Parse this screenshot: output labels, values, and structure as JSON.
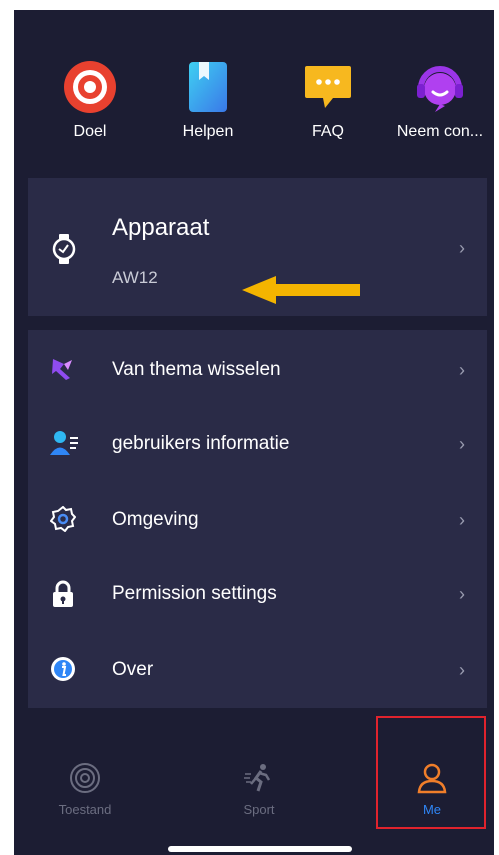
{
  "quick_actions": [
    {
      "label": "Doel",
      "icon": "target-icon"
    },
    {
      "label": "Helpen",
      "icon": "help-book-icon"
    },
    {
      "label": "FAQ",
      "icon": "chat-bubble-icon"
    },
    {
      "label": "Neem con...",
      "icon": "support-headset-icon"
    }
  ],
  "device": {
    "title": "Apparaat",
    "model": "AW12",
    "chevron": "›",
    "arrow_color": "#f4b400"
  },
  "menu": [
    {
      "label": "Van thema wisselen",
      "icon": "theme-flag-icon"
    },
    {
      "label": "gebruikers informatie",
      "icon": "user-info-icon"
    },
    {
      "label": "Omgeving",
      "icon": "settings-gear-icon"
    },
    {
      "label": "Permission settings",
      "icon": "lock-icon"
    },
    {
      "label": "Over",
      "icon": "info-icon"
    }
  ],
  "chevron": "›",
  "tabs": [
    {
      "label": "Toestand",
      "icon": "status-rings-icon",
      "active": false
    },
    {
      "label": "Sport",
      "icon": "running-person-icon",
      "active": false
    },
    {
      "label": "Me",
      "icon": "person-icon",
      "active": true
    }
  ],
  "colors": {
    "background": "#1c1d33",
    "card": "#2a2b47",
    "accent_tab": "#2f86f6",
    "accent_icon": "#f07e2a",
    "inactive_tab": "#6b6d80",
    "highlight": "#e0232d"
  }
}
